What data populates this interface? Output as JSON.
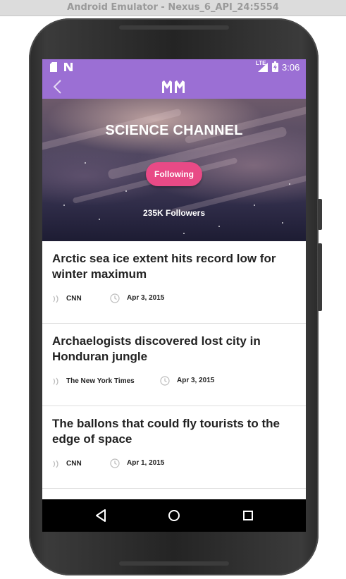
{
  "window": {
    "title": "Android Emulator - Nexus_6_API_24:5554"
  },
  "status_bar": {
    "time": "3:06",
    "network": "LTE"
  },
  "app_bar": {
    "logo": "MM",
    "back_icon": "chevron-left-icon"
  },
  "channel": {
    "title": "SCIENCE CHANNEL",
    "follow_label": "Following",
    "followers": "235K Followers"
  },
  "articles": [
    {
      "title": "Arctic sea ice extent hits record low for winter maximum",
      "source": "CNN",
      "date": "Apr 3, 2015"
    },
    {
      "title": "Archaelogists discovered lost city in Honduran jungle",
      "source": "The New York Times",
      "date": "Apr 3, 2015"
    },
    {
      "title": "The ballons that could fly tourists to the edge of space",
      "source": "CNN",
      "date": "Apr 1, 2015"
    }
  ],
  "colors": {
    "accent": "#9b6fd4",
    "follow_button": "#e84a86"
  },
  "nav": {
    "back": "back-triangle-icon",
    "home": "home-circle-icon",
    "recents": "recents-square-icon"
  }
}
